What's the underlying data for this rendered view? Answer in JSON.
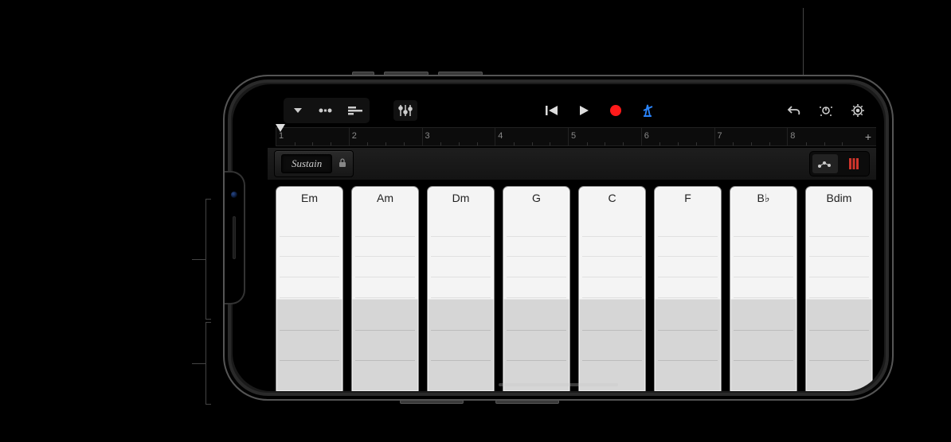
{
  "toolbar": {
    "icons": {
      "browser": "browser-menu",
      "tracks": "tracks-view",
      "regions": "regions-view",
      "mixer": "mixer",
      "rewind": "go-to-beginning",
      "play": "play",
      "record": "record",
      "metronome": "metronome",
      "undo": "undo",
      "nav": "navigation",
      "settings": "settings"
    }
  },
  "ruler": {
    "bars": [
      "1",
      "2",
      "3",
      "4",
      "5",
      "6",
      "7",
      "8"
    ],
    "add_label": "+"
  },
  "controls": {
    "sustain_label": "Sustain",
    "lock": "locked",
    "view_mode": "chord-strips"
  },
  "chords": [
    {
      "label": "Em"
    },
    {
      "label": "Am"
    },
    {
      "label": "Dm"
    },
    {
      "label": "G"
    },
    {
      "label": "C"
    },
    {
      "label": "F"
    },
    {
      "label": "B♭"
    },
    {
      "label": "Bdim"
    }
  ],
  "colors": {
    "accent_blue": "#2b86ff",
    "record_red": "#ff1a1a",
    "strip_accent_red": "#d0352c"
  }
}
